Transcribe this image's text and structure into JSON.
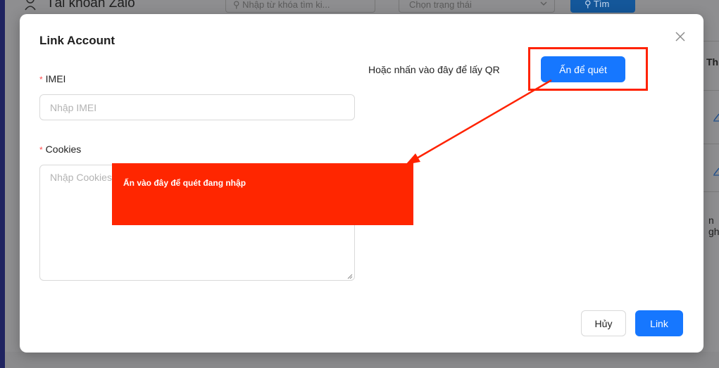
{
  "background": {
    "title": "Tài khoản Zalo",
    "search_placeholder": "Nhập từ khóa tìm ki...",
    "status_placeholder": "Chọn trạng thái",
    "search_button": "Tìm",
    "column_fragment": "Th",
    "row_fragment": "n gh"
  },
  "modal": {
    "title": "Link Account",
    "imei_label": "IMEI",
    "imei_placeholder": "Nhập IMEI",
    "cookies_label": "Cookies",
    "cookies_placeholder": "Nhập Cookies",
    "qr_text": "Hoặc nhấn vào đây để lấy QR",
    "scan_button": "Ấn để quét",
    "cancel_button": "Hủy",
    "link_button": "Link",
    "required_mark": "*"
  },
  "annotation": {
    "text": "Ấn vào đây để quét đang nhập"
  },
  "colors": {
    "primary": "#1677ff",
    "annotation_red": "#ff2600",
    "required": "#ff4d4f"
  }
}
